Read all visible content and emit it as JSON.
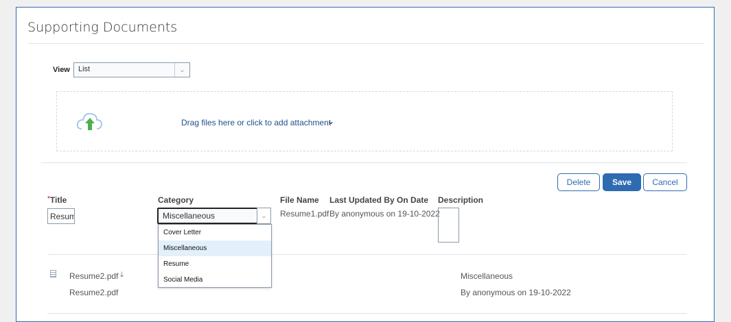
{
  "page": {
    "title": "Supporting Documents"
  },
  "view": {
    "label": "View",
    "value": "List"
  },
  "upload": {
    "text": "Drag files here or click to add attachment"
  },
  "buttons": {
    "delete": "Delete",
    "save": "Save",
    "cancel": "Cancel"
  },
  "columns": {
    "required_mark": "*",
    "title": "Title",
    "category": "Category",
    "file_name": "File Name",
    "last_updated": "Last Updated By On Date",
    "description": "Description"
  },
  "edit_row": {
    "title_value": "Resume",
    "category_value": "Miscellaneous",
    "file_name": "Resume1.pdf",
    "last_updated": "By anonymous on 19-10-2022",
    "description": ""
  },
  "category_options": [
    "Cover Letter",
    "Miscellaneous",
    "Resume",
    "Social Media"
  ],
  "rows": [
    {
      "title": "Resume2.pdf",
      "file_name": "Resume2.pdf",
      "category": "Miscellaneous",
      "last_updated": "By anonymous on 19-10-2022"
    }
  ]
}
